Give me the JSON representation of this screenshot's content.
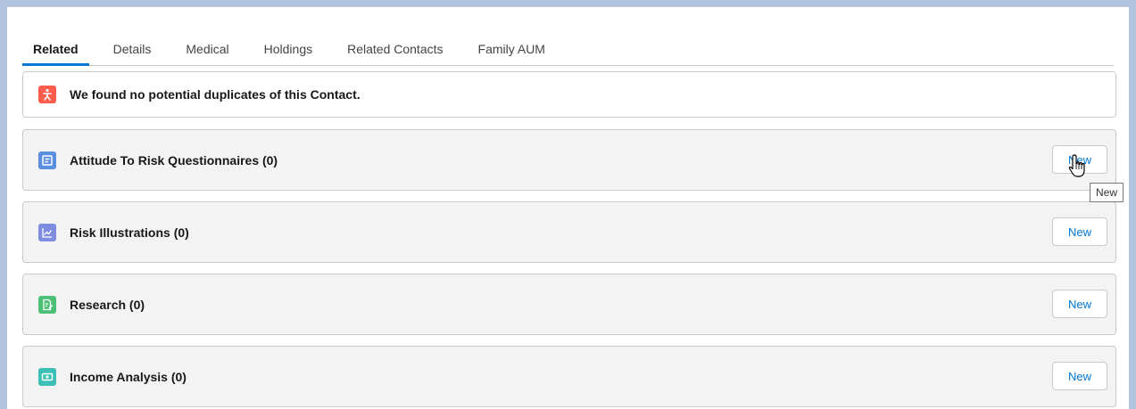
{
  "tabs": [
    {
      "label": "Related",
      "active": true
    },
    {
      "label": "Details"
    },
    {
      "label": "Medical"
    },
    {
      "label": "Holdings"
    },
    {
      "label": "Related Contacts"
    },
    {
      "label": "Family AUM"
    }
  ],
  "duplicates": {
    "message": "We found no potential duplicates of this Contact.",
    "icon": "duplicate-contact-icon",
    "icon_color": "#fe5c4c"
  },
  "related_lists": [
    {
      "title": "Attitude To Risk Questionnaires (0)",
      "button": "New",
      "icon": "questionnaire-icon",
      "icon_color": "#5a8fe0"
    },
    {
      "title": "Risk Illustrations (0)",
      "button": "New",
      "icon": "line-chart-icon",
      "icon_color": "#7f8de1"
    },
    {
      "title": "Research (0)",
      "button": "New",
      "icon": "document-edit-icon",
      "icon_color": "#4bc076"
    },
    {
      "title": "Income Analysis (0)",
      "button": "New",
      "icon": "money-icon",
      "icon_color": "#3cbfb4"
    }
  ],
  "tooltip": "New"
}
